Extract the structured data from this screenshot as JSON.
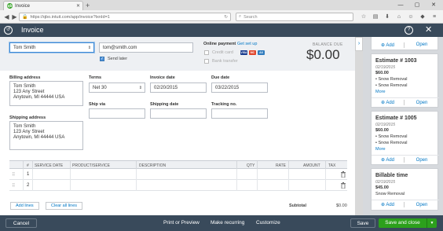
{
  "browser": {
    "tab_title": "Invoice",
    "tab_favicon": "qb",
    "url": "https://qbo.intuit.com/app/invoice?txnId=1",
    "search_placeholder": "Search"
  },
  "header": {
    "title": "Invoice"
  },
  "customer": {
    "name": "Tom Smith",
    "email": "tom@smith.com",
    "send_later_label": "Send later"
  },
  "payment": {
    "label": "Online payment",
    "setup_link": "Get set up",
    "credit_card_label": "Credit card",
    "bank_transfer_label": "Bank transfer"
  },
  "balance": {
    "label": "BALANCE DUE",
    "amount": "$0.00"
  },
  "billing": {
    "label": "Billing address",
    "lines": [
      "Tom Smith",
      "123 Any Street",
      "Anytown, MI  44444 USA"
    ]
  },
  "shipping": {
    "label": "Shipping address",
    "lines": [
      "Tom Smith",
      "123 Any Street",
      "Anytown, MI  44444 USA"
    ]
  },
  "terms": {
    "label": "Terms",
    "value": "Net 30"
  },
  "invoice_date": {
    "label": "Invoice date",
    "value": "02/20/2015"
  },
  "due_date": {
    "label": "Due date",
    "value": "03/22/2015"
  },
  "ship_via": {
    "label": "Ship via",
    "value": ""
  },
  "shipping_date": {
    "label": "Shipping date",
    "value": ""
  },
  "tracking": {
    "label": "Tracking no.",
    "value": ""
  },
  "table": {
    "columns": [
      "#",
      "SERVICE DATE",
      "PRODUCT/SERVICE",
      "DESCRIPTION",
      "QTY",
      "RATE",
      "AMOUNT",
      "TAX"
    ],
    "rows": [
      {
        "num": "1"
      },
      {
        "num": "2"
      }
    ],
    "add_lines": "Add lines",
    "clear_lines": "Clear all lines",
    "subtotal_label": "Subtotal",
    "subtotal_value": "$0.00"
  },
  "panel": {
    "top_actions": {
      "add": "Add",
      "open": "Open"
    },
    "cards": [
      {
        "title": "Estimate # 1003",
        "date": "02/19/2015",
        "amount": "$60.00",
        "items": [
          "Snow Removal",
          "Snow Removal"
        ],
        "more": "More",
        "add": "Add",
        "open": "Open"
      },
      {
        "title": "Estimate # 1005",
        "date": "02/19/2015",
        "amount": "$60.00",
        "items": [
          "Snow Removal",
          "Snow Removal"
        ],
        "more": "More",
        "add": "Add",
        "open": "Open"
      },
      {
        "title": "Billable time",
        "date": "02/19/2015",
        "amount": "$45.00",
        "items": [
          "Snow Removal"
        ],
        "add": "Add",
        "open": "Open"
      }
    ]
  },
  "footer": {
    "cancel": "Cancel",
    "print": "Print or Preview",
    "recurring": "Make recurring",
    "customize": "Customize",
    "save": "Save",
    "save_close": "Save and close"
  },
  "colors": {
    "header_bg": "#394a5b",
    "accent_green": "#2ca01c",
    "link_blue": "#0077c5"
  }
}
